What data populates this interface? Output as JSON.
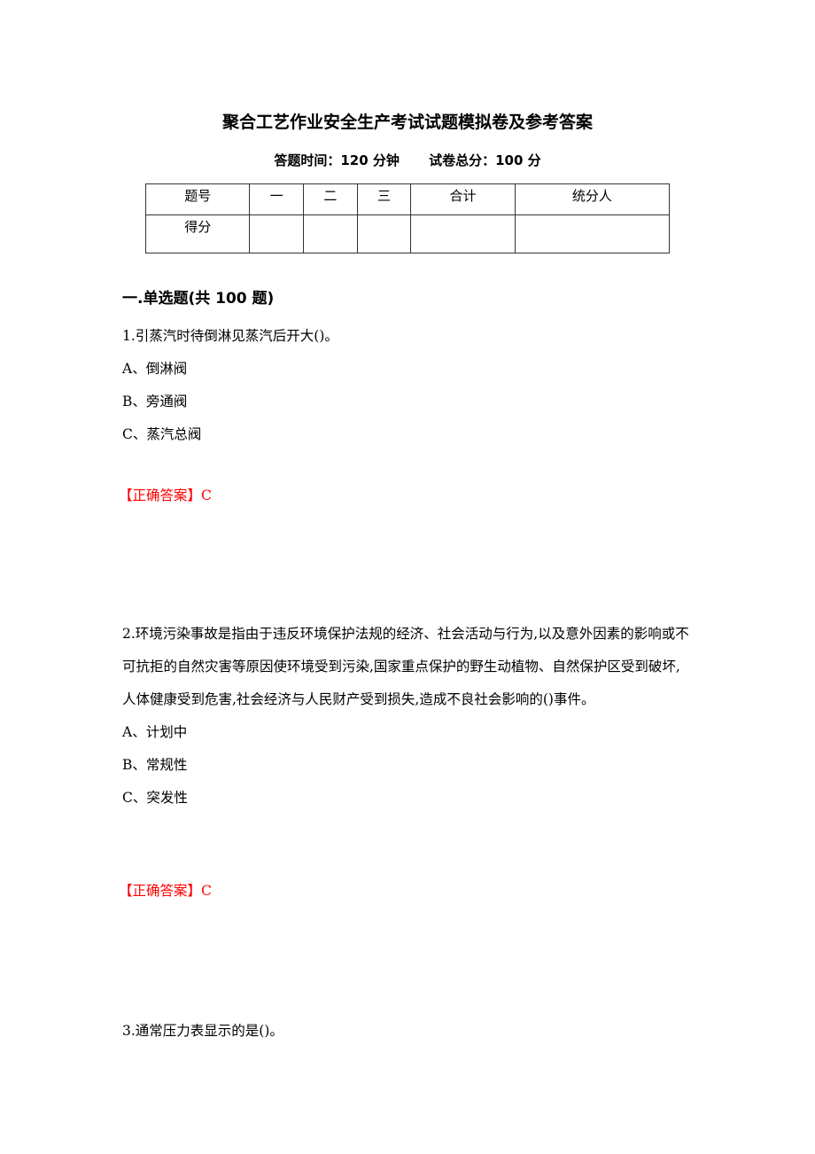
{
  "document": {
    "title": "聚合工艺作业安全生产考试试题模拟卷及参考答案",
    "duration": "答题时间：120 分钟",
    "total_score": "试卷总分：100 分",
    "score_table": {
      "header": [
        "题号",
        "一",
        "二",
        "三",
        "合计",
        "统分人"
      ],
      "row": [
        "得分",
        "",
        "",
        "",
        "",
        ""
      ]
    },
    "section_title": "一.单选题(共 100 题)",
    "questions": [
      {
        "stem": "1.引蒸汽时待倒淋见蒸汽后开大()。",
        "options": [
          "A、倒淋阀",
          "B、旁通阀",
          "C、蒸汽总阀"
        ],
        "answer": "【正确答案】C"
      },
      {
        "stem": "2.环境污染事故是指由于违反环境保护法规的经济、社会活动与行为,以及意外因素的影响或不可抗拒的自然灾害等原因使环境受到污染,国家重点保护的野生动植物、自然保护区受到破坏,人体健康受到危害,社会经济与人民财产受到损失,造成不良社会影响的()事件。",
        "options": [
          "A、计划中",
          "B、常规性",
          "C、突发性"
        ],
        "answer": "【正确答案】C"
      },
      {
        "stem": "3.通常压力表显示的是()。"
      }
    ]
  }
}
